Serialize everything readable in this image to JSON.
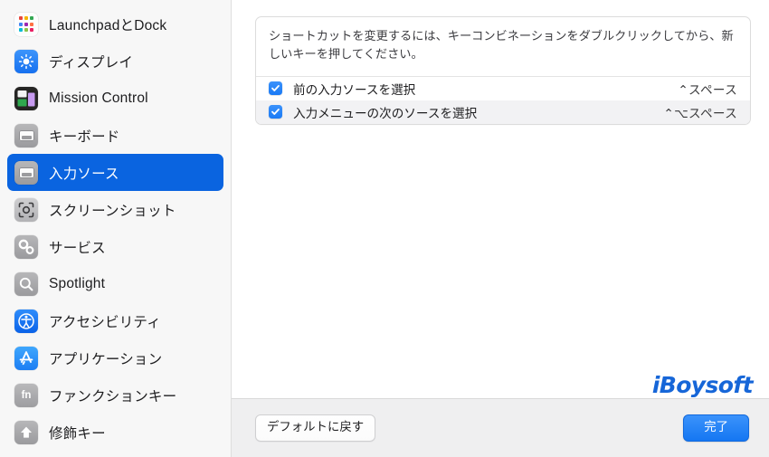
{
  "window": {
    "accent_color": "#0a64e0",
    "checkbox_color": "#1a7af5",
    "watermark": "iBoysoft"
  },
  "sidebar": {
    "items": [
      {
        "label": "LaunchpadとDock",
        "icon": "launchpad-icon",
        "selected": false
      },
      {
        "label": "ディスプレイ",
        "icon": "display-icon",
        "selected": false
      },
      {
        "label": "Mission Control",
        "icon": "mission-control-icon",
        "selected": false
      },
      {
        "label": "キーボード",
        "icon": "keyboard-icon",
        "selected": false
      },
      {
        "label": "入力ソース",
        "icon": "input-source-icon",
        "selected": true
      },
      {
        "label": "スクリーンショット",
        "icon": "screenshot-icon",
        "selected": false
      },
      {
        "label": "サービス",
        "icon": "services-icon",
        "selected": false
      },
      {
        "label": "Spotlight",
        "icon": "spotlight-icon",
        "selected": false
      },
      {
        "label": "アクセシビリティ",
        "icon": "accessibility-icon",
        "selected": false
      },
      {
        "label": "アプリケーション",
        "icon": "applications-icon",
        "selected": false
      },
      {
        "label": "ファンクションキー",
        "icon": "function-keys-icon",
        "selected": false
      },
      {
        "label": "修飾キー",
        "icon": "modifier-keys-icon",
        "selected": false
      }
    ]
  },
  "main": {
    "description": "ショートカットを変更するには、キーコンビネーションをダブルクリックしてから、新しいキーを押してください。",
    "shortcuts": [
      {
        "title": "前の入力ソースを選択",
        "key": "⌃スペース",
        "checked": true
      },
      {
        "title": "入力メニューの次のソースを選択",
        "key": "⌃⌥スペース",
        "checked": true
      }
    ]
  },
  "footer": {
    "restore_defaults_label": "デフォルトに戻す",
    "done_label": "完了"
  }
}
